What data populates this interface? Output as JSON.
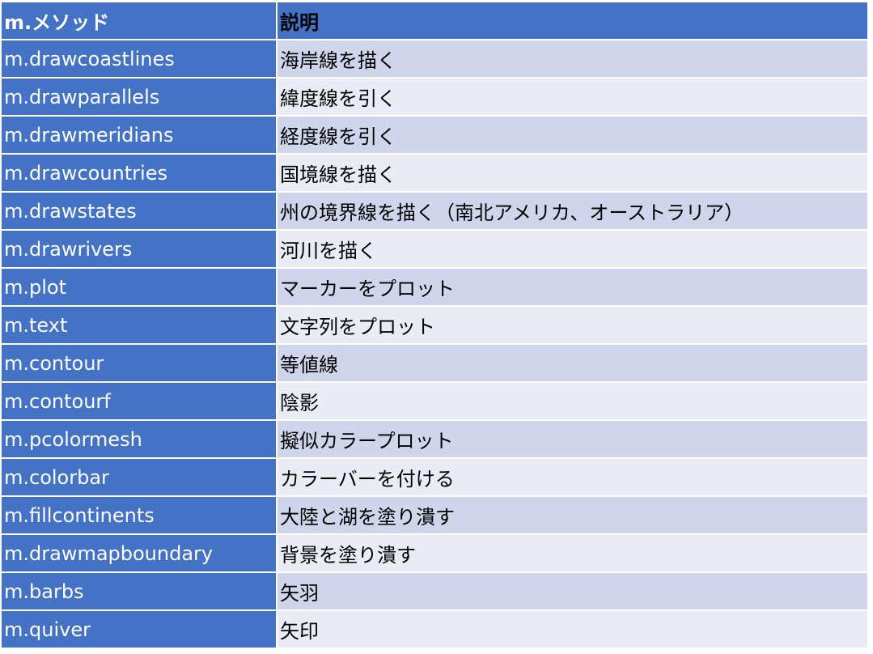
{
  "header": {
    "method": "m.メソッド",
    "description": "説明"
  },
  "rows": [
    {
      "method": "m.drawcoastlines",
      "description": "海岸線を描く"
    },
    {
      "method": "m.drawparallels",
      "description": "緯度線を引く"
    },
    {
      "method": "m.drawmeridians",
      "description": "経度線を引く"
    },
    {
      "method": "m.drawcountries",
      "description": "国境線を描く"
    },
    {
      "method": "m.drawstates",
      "description": "州の境界線を描く（南北アメリカ、オーストラリア）"
    },
    {
      "method": "m.drawrivers",
      "description": "河川を描く"
    },
    {
      "method": "m.plot",
      "description": "マーカーをプロット"
    },
    {
      "method": "m.text",
      "description": "文字列をプロット"
    },
    {
      "method": "m.contour",
      "description": "等値線"
    },
    {
      "method": "m.contourf",
      "description": "陰影"
    },
    {
      "method": "m.pcolormesh",
      "description": "擬似カラープロット"
    },
    {
      "method": "m.colorbar",
      "description": "カラーバーを付ける"
    },
    {
      "method": "m.fillcontinents",
      "description": "大陸と湖を塗り潰す"
    },
    {
      "method": "m.drawmapboundary",
      "description": "背景を塗り潰す"
    },
    {
      "method": "m.barbs",
      "description": "矢羽"
    },
    {
      "method": "m.quiver",
      "description": "矢印"
    }
  ],
  "colors": {
    "header_bg": "#4472c4",
    "method_bg": "#4472c4",
    "desc_odd_bg": "#cfd5ea",
    "desc_even_bg": "#e9ebf5"
  }
}
